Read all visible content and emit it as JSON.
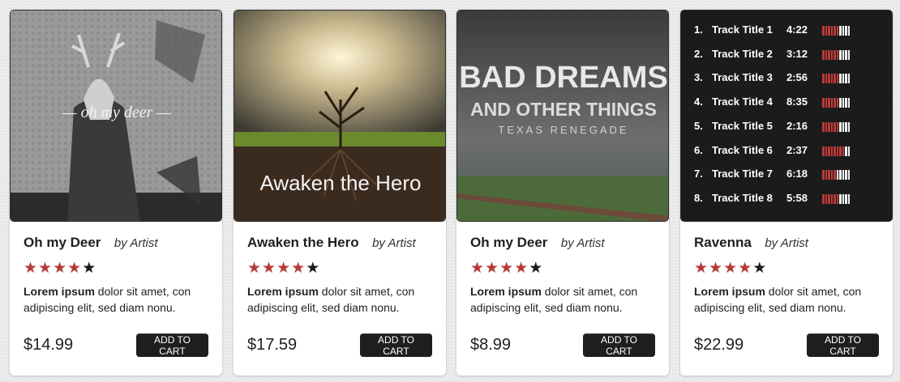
{
  "products": [
    {
      "title": "Oh my Deer",
      "artist": "by Artist",
      "rating": 4,
      "max_rating": 5,
      "desc_bold": "Lorem ipsum",
      "desc_rest": " dolor sit amet, con adipiscing elit, sed diam nonu.",
      "price": "$14.99",
      "cart_label": "ADD TO CART",
      "cover_text": "— oh my deer —"
    },
    {
      "title": "Awaken the Hero",
      "artist": "by Artist",
      "rating": 4,
      "max_rating": 5,
      "desc_bold": "Lorem ipsum",
      "desc_rest": " dolor sit amet, con adipiscing elit, sed diam nonu.",
      "price": "$17.59",
      "cart_label": "ADD TO CART",
      "cover_text": "Awaken the Hero"
    },
    {
      "title": "Oh my Deer",
      "artist": "by Artist",
      "rating": 4,
      "max_rating": 5,
      "desc_bold": "Lorem ipsum",
      "desc_rest": " dolor sit amet, con adipiscing elit, sed diam nonu.",
      "price": "$8.99",
      "cart_label": "ADD TO CART",
      "cover_line1": "BAD DREAMS",
      "cover_line2": "AND OTHER THINGS",
      "cover_line3": "TEXAS RENEGADE"
    },
    {
      "title": "Ravenna",
      "artist": "by Artist",
      "rating": 4,
      "max_rating": 5,
      "desc_bold": "Lorem ipsum",
      "desc_rest": " dolor sit amet, con adipiscing elit, sed diam nonu.",
      "price": "$22.99",
      "cart_label": "ADD TO CART",
      "tracks": [
        {
          "num": "1.",
          "name": "Track Title 1",
          "duration": "4:22",
          "level": 0.6
        },
        {
          "num": "2.",
          "name": "Track Title 2",
          "duration": "3:12",
          "level": 0.6
        },
        {
          "num": "3.",
          "name": "Track Title 3",
          "duration": "2:56",
          "level": 0.6
        },
        {
          "num": "4.",
          "name": "Track Title 4",
          "duration": "8:35",
          "level": 0.6
        },
        {
          "num": "5.",
          "name": "Track Title 5",
          "duration": "2:16",
          "level": 0.6
        },
        {
          "num": "6.",
          "name": "Track Title 6",
          "duration": "2:37",
          "level": 0.8
        },
        {
          "num": "7.",
          "name": "Track Title 7",
          "duration": "6:18",
          "level": 0.5
        },
        {
          "num": "8.",
          "name": "Track Title 8",
          "duration": "5:58",
          "level": 0.6
        }
      ]
    }
  ],
  "colors": {
    "star_on": "#b53a3a",
    "star_off": "#1a1a1a",
    "button_bg": "#1e1e1e",
    "meter_red": "#b93a3a"
  }
}
